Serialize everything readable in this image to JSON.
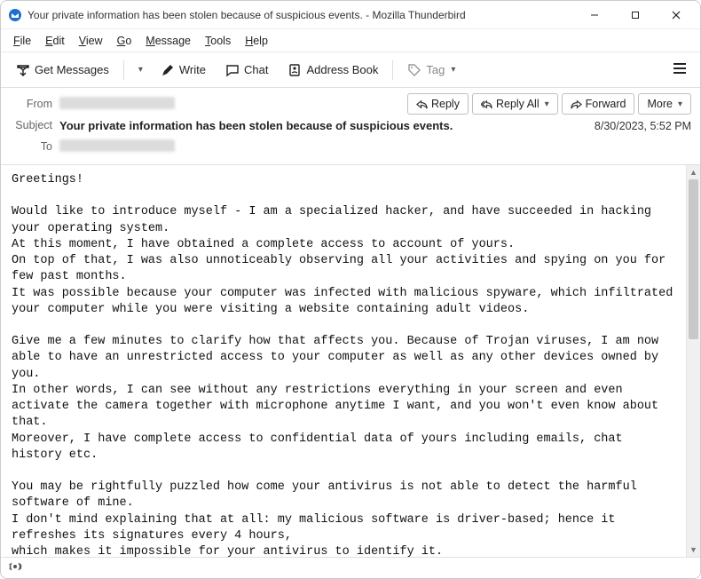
{
  "window": {
    "title": "Your private information has been stolen because of suspicious events. - Mozilla Thunderbird"
  },
  "menu": {
    "file": "File",
    "edit": "Edit",
    "view": "View",
    "go": "Go",
    "message": "Message",
    "tools": "Tools",
    "help": "Help"
  },
  "toolbar": {
    "get_messages": "Get Messages",
    "write": "Write",
    "chat": "Chat",
    "address_book": "Address Book",
    "tag": "Tag"
  },
  "actions": {
    "reply": "Reply",
    "reply_all": "Reply All",
    "forward": "Forward",
    "more": "More"
  },
  "header": {
    "from_label": "From",
    "subject_label": "Subject",
    "to_label": "To",
    "subject": "Your private information has been stolen because of suspicious events.",
    "datetime": "8/30/2023, 5:52 PM"
  },
  "body": "Greetings!\n\nWould like to introduce myself - I am a specialized hacker, and have succeeded in hacking your operating system.\nAt this moment, I have obtained a complete access to account of yours.\nOn top of that, I was also unnoticeably observing all your activities and spying on you for few past months.\nIt was possible because your computer was infected with malicious spyware, which infiltrated your computer while you were visiting a website containing adult videos.\n\nGive me a few minutes to clarify how that affects you. Because of Trojan viruses, I am now able to have an unrestricted access to your computer as well as any other devices owned by you.\nIn other words, I can see without any restrictions everything in your screen and even activate the camera together with microphone anytime I want, and you won't even know about that.\nMoreover, I have complete access to confidential data of yours including emails, chat history etc.\n\nYou may be rightfully puzzled how come your antivirus is not able to detect the harmful software of mine.\nI don't mind explaining that at all: my malicious software is driver-based; hence it refreshes its signatures every 4 hours,\nwhich makes it impossible for your antivirus to identify it."
}
